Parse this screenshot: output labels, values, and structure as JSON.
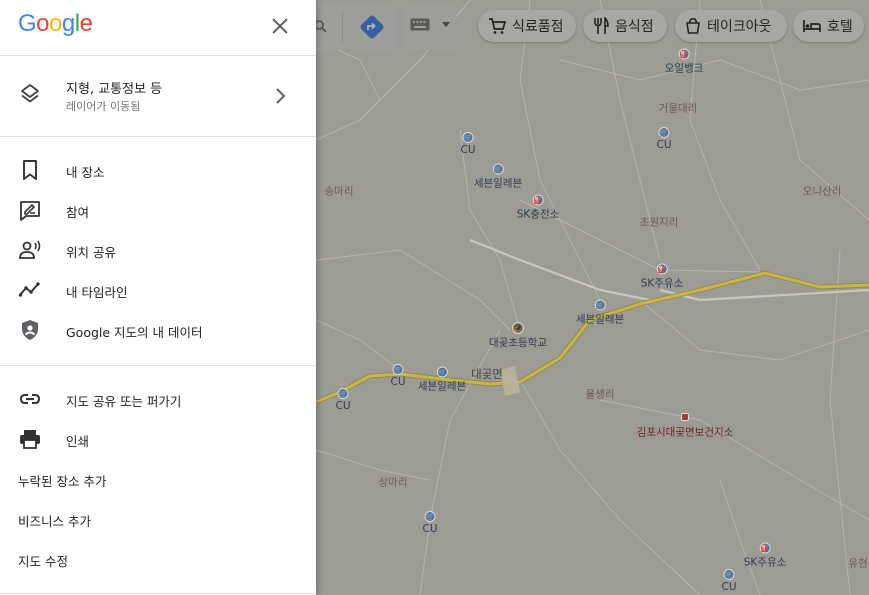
{
  "panel": {
    "logo_letters": [
      "G",
      "o",
      "o",
      "g",
      "l",
      "e"
    ],
    "close_icon": "close-icon",
    "layers": {
      "title": "지형, 교통정보 등",
      "subtitle": "레이어가 이동됨",
      "icon": "layers-icon"
    },
    "menu_group_1": [
      {
        "label": "내 장소",
        "icon": "bookmark-icon"
      },
      {
        "label": "참여",
        "icon": "contribute-icon"
      },
      {
        "label": "위치 공유",
        "icon": "location-sharing-icon"
      },
      {
        "label": "내 타임라인",
        "icon": "timeline-icon"
      },
      {
        "label": "Google 지도의 내 데이터",
        "icon": "shield-account-icon"
      }
    ],
    "menu_group_2": [
      {
        "label": "지도 공유 또는 퍼가기",
        "icon": "link-icon"
      },
      {
        "label": "인쇄",
        "icon": "print-icon"
      },
      {
        "label": "누락된 장소 추가"
      },
      {
        "label": "비즈니스 추가"
      },
      {
        "label": "지도 수정"
      }
    ]
  },
  "map_toolbar": {
    "chips": [
      {
        "label": "식료품점",
        "icon": "cart-icon"
      },
      {
        "label": "음식점",
        "icon": "restaurant-icon"
      },
      {
        "label": "테이크아웃",
        "icon": "takeout-icon"
      },
      {
        "label": "호텔",
        "icon": "hotel-icon"
      }
    ]
  },
  "map": {
    "place_labels": [
      {
        "text": "송마리",
        "kind": "area"
      },
      {
        "text": "거물대리",
        "kind": "area"
      },
      {
        "text": "오니산리",
        "kind": "area"
      },
      {
        "text": "초원지리",
        "kind": "area"
      },
      {
        "text": "대곶면",
        "kind": "town"
      },
      {
        "text": "율생리",
        "kind": "area"
      },
      {
        "text": "상마리",
        "kind": "area"
      },
      {
        "text": "유현",
        "kind": "area"
      },
      {
        "text": "김포시대곶면보건지소",
        "kind": "clinic"
      }
    ],
    "pois": [
      {
        "label": "오일뱅크"
      },
      {
        "label": "CU"
      },
      {
        "label": "CU"
      },
      {
        "label": "세븐일레븐"
      },
      {
        "label": "SK충전소"
      },
      {
        "label": "SK주유소"
      },
      {
        "label": "세븐일레븐"
      },
      {
        "label": "대곶초등학교"
      },
      {
        "label": "CU"
      },
      {
        "label": "세븐일레븐"
      },
      {
        "label": "CU"
      },
      {
        "label": "CU"
      },
      {
        "label": "SK주유소"
      },
      {
        "label": "CU"
      }
    ]
  }
}
